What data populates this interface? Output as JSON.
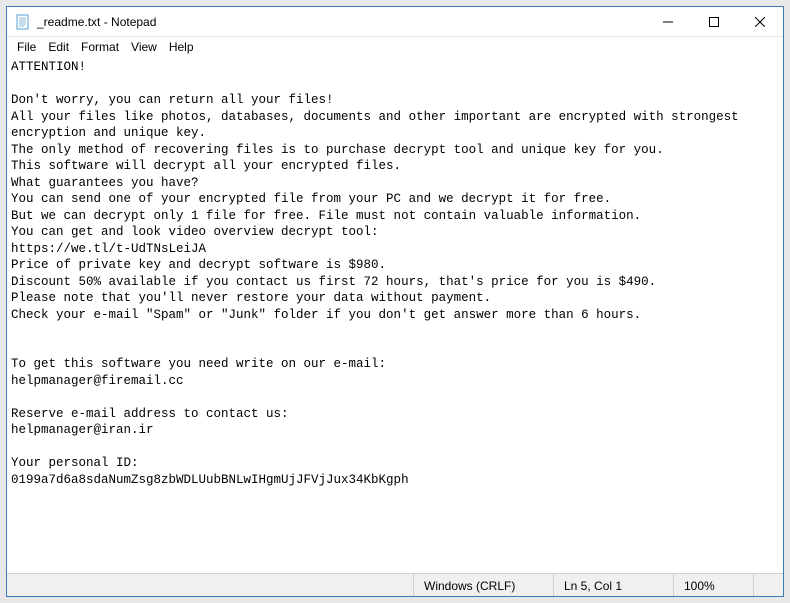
{
  "titlebar": {
    "title": "_readme.txt - Notepad"
  },
  "menu": {
    "file": "File",
    "edit": "Edit",
    "format": "Format",
    "view": "View",
    "help": "Help"
  },
  "body": "ATTENTION!\n\nDon't worry, you can return all your files!\nAll your files like photos, databases, documents and other important are encrypted with strongest encryption and unique key.\nThe only method of recovering files is to purchase decrypt tool and unique key for you.\nThis software will decrypt all your encrypted files.\nWhat guarantees you have?\nYou can send one of your encrypted file from your PC and we decrypt it for free.\nBut we can decrypt only 1 file for free. File must not contain valuable information.\nYou can get and look video overview decrypt tool:\nhttps://we.tl/t-UdTNsLeiJA\nPrice of private key and decrypt software is $980.\nDiscount 50% available if you contact us first 72 hours, that's price for you is $490.\nPlease note that you'll never restore your data without payment.\nCheck your e-mail \"Spam\" or \"Junk\" folder if you don't get answer more than 6 hours.\n\n\nTo get this software you need write on our e-mail:\nhelpmanager@firemail.cc\n\nReserve e-mail address to contact us:\nhelpmanager@iran.ir\n\nYour personal ID:\n0199a7d6a8sdaNumZsg8zbWDLUubBNLwIHgmUjJFVjJux34KbKgph",
  "status": {
    "encoding": "Windows (CRLF)",
    "position": "Ln 5, Col 1",
    "zoom": "100%"
  }
}
